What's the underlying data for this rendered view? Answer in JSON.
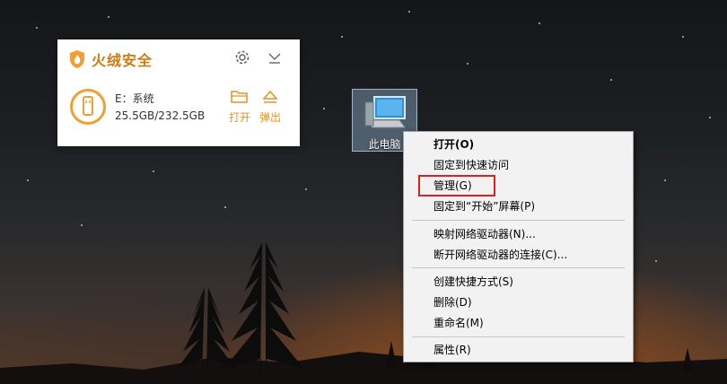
{
  "security_widget": {
    "brand": "火绒安全",
    "drive_name": "E：系统",
    "drive_size": "25.5GB/232.5GB",
    "open_label": "打开",
    "eject_label": "弹出",
    "accent_color": "#e8901e"
  },
  "desktop": {
    "this_pc_label": "此电脑"
  },
  "context_menu": {
    "items": [
      {
        "label": "打开(O)"
      },
      {
        "label": "固定到快速访问"
      },
      {
        "label": "管理(G)"
      },
      {
        "label": "固定到“开始”屏幕(P)"
      },
      {
        "label": "映射网络驱动器(N)..."
      },
      {
        "label": "断开网络驱动器的连接(C)..."
      },
      {
        "label": "创建快捷方式(S)"
      },
      {
        "label": "删除(D)"
      },
      {
        "label": "重命名(M)"
      },
      {
        "label": "属性(R)"
      }
    ],
    "highlight_color": "#e02020"
  }
}
